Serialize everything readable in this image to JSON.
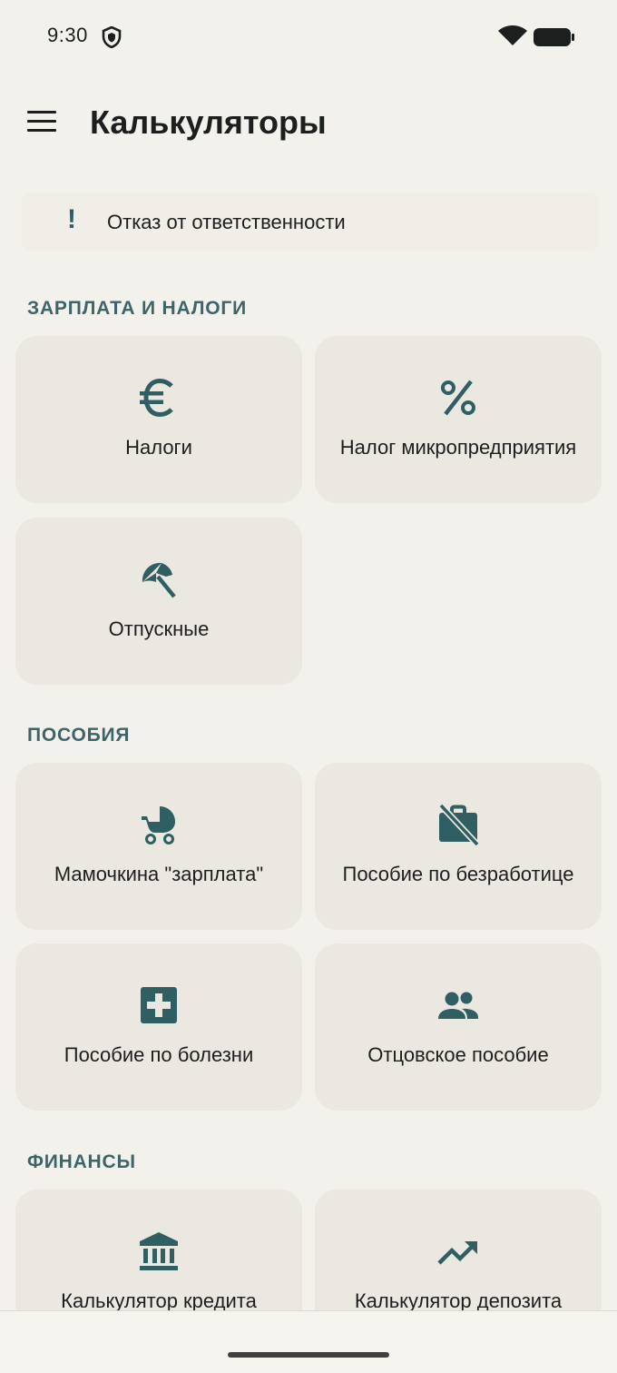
{
  "status": {
    "time": "9:30",
    "icons": [
      "shield-icon",
      "wifi-icon",
      "battery-icon"
    ]
  },
  "app_bar": {
    "title": "Калькуляторы",
    "menu_icon": "menu-icon"
  },
  "disclaimer": {
    "icon_glyph": "!",
    "text": "Отказ от ответственности"
  },
  "sections": {
    "salary": {
      "title": "ЗАРПЛАТА И НАЛОГИ",
      "items": [
        {
          "label": "Налоги",
          "icon": "euro-icon"
        },
        {
          "label": "Налог микропредприятия",
          "icon": "percent-icon"
        },
        {
          "label": "Отпускные",
          "icon": "beach-umbrella-icon"
        }
      ]
    },
    "benefits": {
      "title": "ПОСОБИЯ",
      "items": [
        {
          "label": "Мамочкина \"зарплата\"",
          "icon": "stroller-icon"
        },
        {
          "label": "Пособие по безработице",
          "icon": "work-off-icon"
        },
        {
          "label": "Пособие по болезни",
          "icon": "medical-cross-icon"
        },
        {
          "label": "Отцовское пособие",
          "icon": "people-icon"
        }
      ]
    },
    "finance": {
      "title": "ФИНАНСЫ",
      "items": [
        {
          "label": "Калькулятор кредита",
          "icon": "bank-icon"
        },
        {
          "label": "Калькулятор депозита",
          "icon": "trending-up-icon"
        }
      ]
    }
  },
  "colors": {
    "background": "#f3f1ec",
    "tile": "#ebe7e1",
    "accent": "#2f5f63",
    "section_title": "#3d6469"
  }
}
